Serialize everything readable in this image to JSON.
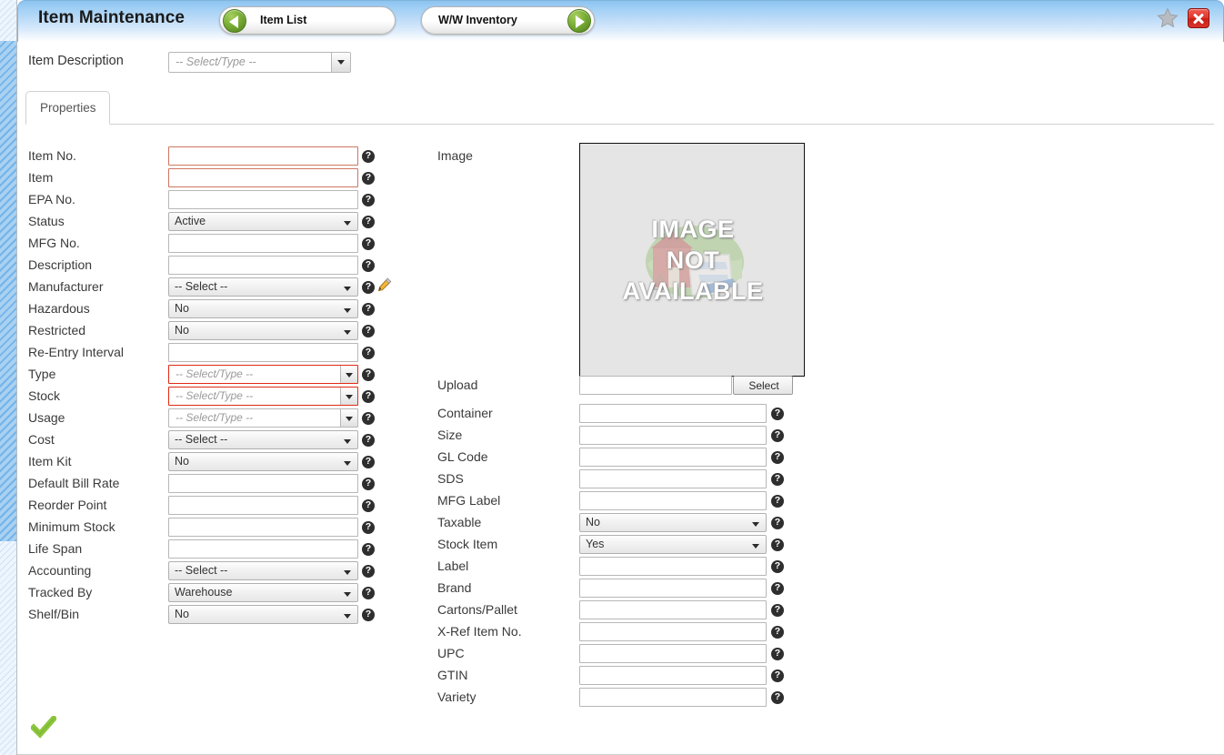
{
  "window": {
    "title": "Item Maintenance",
    "star_icon": "star-icon",
    "close_icon": "close-icon"
  },
  "nav": {
    "prev": {
      "label": "Item List",
      "icon": "arrow-left-circle-icon"
    },
    "next": {
      "label": "W/W Inventory",
      "icon": "arrow-right-circle-icon"
    }
  },
  "item_description": {
    "label": "Item Description",
    "value": "",
    "placeholder": "-- Select/Type --"
  },
  "tabs": [
    {
      "label": "Properties",
      "active": true
    }
  ],
  "help_glyph": "?",
  "left_column": [
    {
      "label": "Item No.",
      "type": "text",
      "value": "",
      "required": true,
      "help": true
    },
    {
      "label": "Item",
      "type": "text",
      "value": "",
      "required": true,
      "help": true
    },
    {
      "label": "EPA No.",
      "type": "text",
      "value": "",
      "required": false,
      "help": true
    },
    {
      "label": "Status",
      "type": "select",
      "value": "Active",
      "help": true
    },
    {
      "label": "MFG No.",
      "type": "text",
      "value": "",
      "required": false,
      "help": true
    },
    {
      "label": "Description",
      "type": "text",
      "value": "",
      "required": false,
      "help": true
    },
    {
      "label": "Manufacturer",
      "type": "select",
      "value": "-- Select --",
      "help": true,
      "edit_icon": "pencil-icon"
    },
    {
      "label": "Hazardous",
      "type": "select",
      "value": "No",
      "help": true
    },
    {
      "label": "Restricted",
      "type": "select",
      "value": "No",
      "help": true
    },
    {
      "label": "Re-Entry Interval",
      "type": "text",
      "value": "",
      "required": false,
      "help": true
    },
    {
      "label": "Type",
      "type": "combo",
      "value": "",
      "placeholder": "-- Select/Type --",
      "required": true,
      "help": true
    },
    {
      "label": "Stock",
      "type": "combo",
      "value": "",
      "placeholder": "-- Select/Type --",
      "required": true,
      "help": true
    },
    {
      "label": "Usage",
      "type": "combo",
      "value": "",
      "placeholder": "-- Select/Type --",
      "required": false,
      "help": true
    },
    {
      "label": "Cost",
      "type": "select",
      "value": "-- Select --",
      "help": true
    },
    {
      "label": "Item Kit",
      "type": "select",
      "value": "No",
      "help": true
    },
    {
      "label": "Default Bill Rate",
      "type": "text",
      "value": "",
      "required": false,
      "help": true
    },
    {
      "label": "Reorder Point",
      "type": "text",
      "value": "",
      "required": false,
      "help": true
    },
    {
      "label": "Minimum Stock",
      "type": "text",
      "value": "",
      "required": false,
      "help": true
    },
    {
      "label": "Life Span",
      "type": "text",
      "value": "",
      "required": false,
      "help": true
    },
    {
      "label": "Accounting",
      "type": "select",
      "value": "-- Select --",
      "help": true
    },
    {
      "label": "Tracked By",
      "type": "select",
      "value": "Warehouse",
      "help": true
    },
    {
      "label": "Shelf/Bin",
      "type": "select",
      "value": "No",
      "help": true
    }
  ],
  "image_section": {
    "label": "Image",
    "placeholder_text": "IMAGE NOT AVAILABLE",
    "placeholder_lines": [
      "IMAGE",
      "NOT",
      "AVAILABLE"
    ],
    "upload_label": "Upload",
    "upload_value": "",
    "select_button": "Select"
  },
  "right_column": [
    {
      "label": "Container",
      "type": "text",
      "value": "",
      "help": true
    },
    {
      "label": "Size",
      "type": "text",
      "value": "",
      "help": true
    },
    {
      "label": "GL Code",
      "type": "text",
      "value": "",
      "help": true
    },
    {
      "label": "SDS",
      "type": "text",
      "value": "",
      "help": true
    },
    {
      "label": "MFG Label",
      "type": "text",
      "value": "",
      "help": true
    },
    {
      "label": "Taxable",
      "type": "select",
      "value": "No",
      "help": true
    },
    {
      "label": "Stock Item",
      "type": "select",
      "value": "Yes",
      "help": true
    },
    {
      "label": "Label",
      "type": "text",
      "value": "",
      "help": true
    },
    {
      "label": "Brand",
      "type": "text",
      "value": "",
      "help": true
    },
    {
      "label": "Cartons/Pallet",
      "type": "text",
      "value": "",
      "help": true
    },
    {
      "label": "X-Ref Item No.",
      "type": "text",
      "value": "",
      "help": true
    },
    {
      "label": "UPC",
      "type": "text",
      "value": "",
      "help": true
    },
    {
      "label": "GTIN",
      "type": "text",
      "value": "",
      "help": true
    },
    {
      "label": "Variety",
      "type": "text",
      "value": "",
      "help": true
    }
  ],
  "footer": {
    "save_icon": "check-icon"
  },
  "colors": {
    "header_blue": "#9ccdf4",
    "accent_green": "#7cb037",
    "close_red": "#d8342b",
    "required_border": "#cf7763",
    "required_border_strong": "#e02a14",
    "image_bg": "#e5e5e5"
  }
}
